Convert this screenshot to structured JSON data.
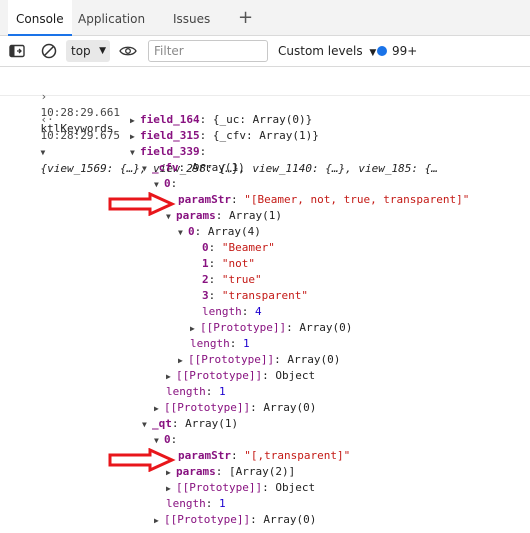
{
  "tabs": [
    {
      "label": "Console"
    },
    {
      "label": "Application"
    },
    {
      "label": "Issues"
    }
  ],
  "toolbar": {
    "context_label": "top",
    "filter_placeholder": "Filter",
    "levels_label": "Custom levels",
    "issues_count": "99+"
  },
  "console": {
    "log1": {
      "time": "10:28:29.661",
      "text": "ktlKeywords"
    },
    "log2": {
      "time": "10:28:29.675",
      "summary": "{view_1569: {…}, view_298: {…}, view_1140: {…}, view_185: {…"
    },
    "lines": [
      {
        "k": "field_164",
        "v": "{_uc: Array(0)}"
      },
      {
        "k": "field_315",
        "v": "{_cfv: Array(1)}"
      },
      {
        "k": "field_339",
        "v": ""
      },
      {
        "k": "_cfv",
        "v": "Array(1)"
      },
      {
        "k": "0",
        "v": ""
      },
      {
        "k": "paramStr",
        "v": "\"[Beamer, not, true, transparent]\""
      },
      {
        "k": "params",
        "v": "Array(1)"
      },
      {
        "k": "0",
        "v": "Array(4)"
      },
      {
        "k": "0",
        "v": "\"Beamer\""
      },
      {
        "k": "1",
        "v": "\"not\""
      },
      {
        "k": "2",
        "v": "\"true\""
      },
      {
        "k": "3",
        "v": "\"transparent\""
      },
      {
        "k": "length",
        "v": "4"
      },
      {
        "k": "[[Prototype]]",
        "v": "Array(0)"
      },
      {
        "k": "length",
        "v": "1"
      },
      {
        "k": "[[Prototype]]",
        "v": "Array(0)"
      },
      {
        "k": "[[Prototype]]",
        "v": "Object"
      },
      {
        "k": "length",
        "v": "1"
      },
      {
        "k": "[[Prototype]]",
        "v": "Array(0)"
      },
      {
        "k": "_qt",
        "v": "Array(1)"
      },
      {
        "k": "0",
        "v": ""
      },
      {
        "k": "paramStr",
        "v": "\"[,transparent]\""
      },
      {
        "k": "params",
        "v": "[Array(2)]"
      },
      {
        "k": "[[Prototype]]",
        "v": "Object"
      },
      {
        "k": "length",
        "v": "1"
      },
      {
        "k": "[[Prototype]]",
        "v": "Array(0)"
      }
    ]
  },
  "colors": {
    "accent": "#1a73e8",
    "annotation_arrow": "#e8161b",
    "property_key": "#881280",
    "string": "#c41a16",
    "number": "#1c00cf"
  }
}
